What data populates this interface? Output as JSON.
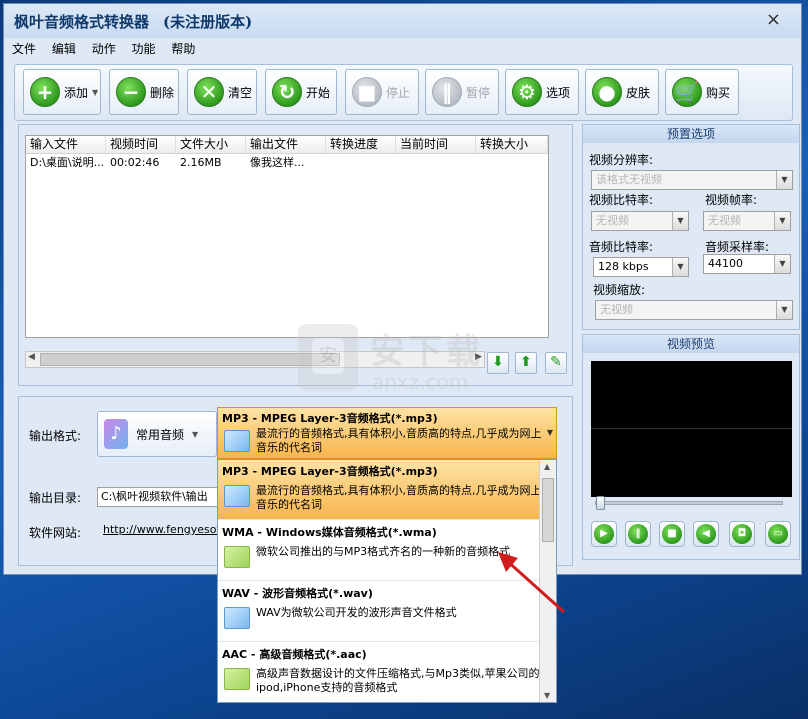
{
  "window": {
    "title": "枫叶音频格式转换器",
    "subtitle": "(未注册版本)",
    "close_glyph": "×"
  },
  "menu": [
    "文件",
    "编辑",
    "动作",
    "功能",
    "帮助"
  ],
  "toolbar": [
    {
      "label": "添加",
      "icon": "+",
      "disabled": false
    },
    {
      "label": "删除",
      "icon": "−",
      "disabled": false
    },
    {
      "label": "清空",
      "icon": "✕",
      "disabled": false
    },
    {
      "label": "开始",
      "icon": "↻",
      "disabled": false
    },
    {
      "label": "停止",
      "icon": "■",
      "disabled": true
    },
    {
      "label": "暂停",
      "icon": "‖",
      "disabled": true
    },
    {
      "label": "选项",
      "icon": "⚙",
      "disabled": false
    },
    {
      "label": "皮肤",
      "icon": "●",
      "disabled": false
    },
    {
      "label": "购买",
      "icon": "🛒",
      "disabled": false
    }
  ],
  "file_list": {
    "columns": [
      "输入文件",
      "视频时间",
      "文件大小",
      "输出文件",
      "转换进度",
      "当前时间",
      "转换大小"
    ],
    "rows": [
      [
        "D:\\桌面\\说明...",
        "00:02:46",
        "2.16MB",
        "像我这样...",
        "",
        "",
        ""
      ]
    ]
  },
  "output": {
    "format_label": "输出格式:",
    "category_label": "常用音频",
    "dir_label": "输出目录:",
    "dir_value": "C:\\枫叶视频软件\\输出",
    "site_label": "软件网站:",
    "site_url": "http://www.fengyesoft.c"
  },
  "format_selected": {
    "title": "MP3 - MPEG Layer-3音频格式(*.mp3)",
    "desc": "最流行的音频格式,具有体积小,音质高的特点,几乎成为网上音乐的代名词"
  },
  "format_options": [
    {
      "title": "MP3 - MPEG Layer-3音频格式(*.mp3)",
      "desc": "最流行的音频格式,具有体积小,音质高的特点,几乎成为网上音乐的代名词",
      "selected": true
    },
    {
      "title": "WMA - Windows媒体音频格式(*.wma)",
      "desc": "微软公司推出的与MP3格式齐名的一种新的音频格式",
      "selected": false
    },
    {
      "title": "WAV - 波形音频格式(*.wav)",
      "desc": "WAV为微软公司开发的波形声音文件格式",
      "selected": false
    },
    {
      "title": "AAC - 高级音频格式(*.aac)",
      "desc": "高级声音数据设计的文件压缩格式,与Mp3类似,苹果公司的ipod,iPhone支持的音频格式",
      "selected": false
    }
  ],
  "preset": {
    "header": "预置选项",
    "video_res_label": "视频分辨率:",
    "video_res_value": "该格式无视频",
    "video_bitrate_label": "视频比特率:",
    "video_bitrate_value": "无视频",
    "video_fps_label": "视频帧率:",
    "video_fps_value": "无视频",
    "audio_bitrate_label": "音频比特率:",
    "audio_bitrate_value": "128 kbps",
    "audio_sample_label": "音频采样率:",
    "audio_sample_value": "44100",
    "video_scale_label": "视频缩放:",
    "video_scale_value": "无视频"
  },
  "preview": {
    "header": "视频预览"
  },
  "watermark": {
    "text": "安下载",
    "url": "anxz.com",
    "shield_glyph": "安"
  },
  "colors": {
    "selected_row": "#f7b54b",
    "accent_green": "#2e9a1e",
    "arrow_red": "#d01c1c"
  }
}
